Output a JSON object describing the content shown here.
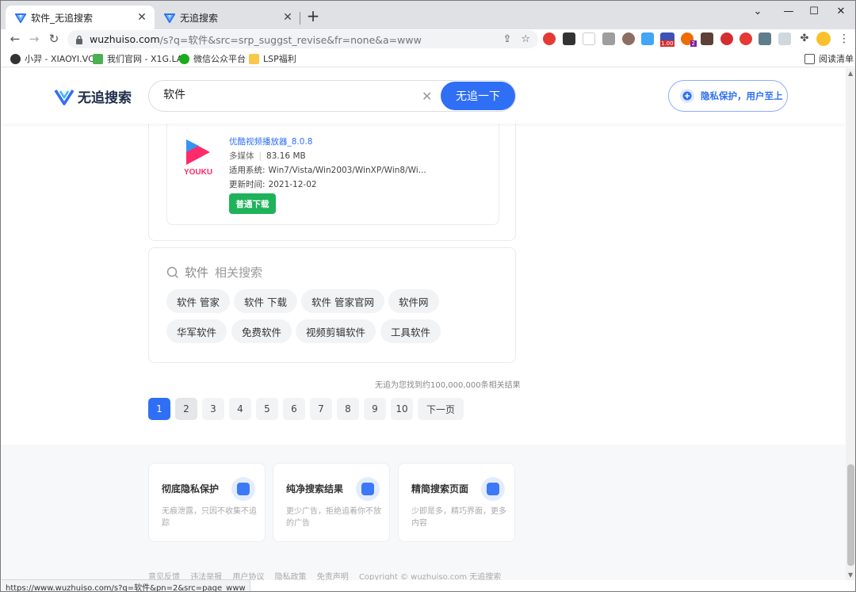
{
  "browser": {
    "tabs": [
      {
        "title": "软件_无追搜索",
        "active": true
      },
      {
        "title": "无追搜索",
        "active": false
      }
    ],
    "url_host": "wuzhuiso.com",
    "url_path": "/s?q=软件&src=srp_suggst_revise&fr=none&a=www",
    "bookmarks": [
      {
        "label": "小羿 - XIAOYI.VC"
      },
      {
        "label": "我们官网 - X1G.LA"
      },
      {
        "label": "微信公众平台"
      },
      {
        "label": "LSP福利"
      }
    ],
    "reading_list": "阅读清单",
    "ext_badges": {
      "count_a": "1.00",
      "count_b": "2"
    },
    "status_url": "https://www.wuzhuiso.com/s?q=软件&pn=2&src=page_www"
  },
  "header": {
    "logo_text": "无追搜索",
    "query": "软件",
    "search_button": "无追一下",
    "privacy_button": "隐私保护，用户至上"
  },
  "result": {
    "title": "优酷视频播放器_8.0.8",
    "category": "多媒体",
    "size": "83.16 MB",
    "os_label": "适用系统:",
    "os_value": "Win7/Vista/Win2003/WinXP/Win8/Wi...",
    "updated_label": "更新时间:",
    "updated_value": "2021-12-02",
    "download_button": "普通下载",
    "logo_text": "YOUKU"
  },
  "related": {
    "keyword": "软件",
    "heading": "相关搜索",
    "row1": [
      "软件 管家",
      "软件 下载",
      "软件 管家官网",
      "软件网"
    ],
    "row2": [
      "华军软件",
      "免费软件",
      "视频剪辑软件",
      "工具软件"
    ]
  },
  "result_count": "无追为您找到约100,000,000条相关结果",
  "pagination": {
    "pages": [
      "1",
      "2",
      "3",
      "4",
      "5",
      "6",
      "7",
      "8",
      "9",
      "10"
    ],
    "current": 1,
    "next": "下一页"
  },
  "features": [
    {
      "title": "彻底隐私保护",
      "desc": "无痕泄露，只因不收集不追踪"
    },
    {
      "title": "纯净搜索结果",
      "desc": "更少广告，拒绝追着你不放的广告"
    },
    {
      "title": "精简搜索页面",
      "desc": "少即是多，精巧界面，更多内容"
    }
  ],
  "footer_links": [
    "意见反馈",
    "违法举报",
    "用户协议",
    "隐私政策",
    "免责声明",
    "Copyright © wuzhuiso.com 无追搜索"
  ],
  "colors": {
    "accent": "#2f6ff5",
    "download": "#1fb25a",
    "youku_pink": "#ff2a6a",
    "youku_blue": "#1ea0ff"
  }
}
